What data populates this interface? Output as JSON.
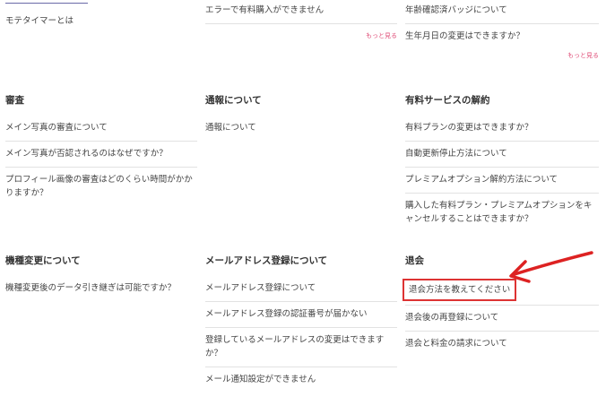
{
  "top": {
    "col1": [
      "モテタイマーとは"
    ],
    "col2": [
      "エラーで有料購入ができません"
    ],
    "col2_more": "もっと見る",
    "col3": [
      "年齢確認済バッジについて",
      "生年月日の変更はできますか？"
    ],
    "col3_more": "もっと見る"
  },
  "sections": [
    {
      "title": "審査",
      "items": [
        "メイン写真の審査について",
        "メイン写真が否認されるのはなぜですか？",
        "プロフィール画像の審査はどのくらい時間がかかりますか？"
      ]
    },
    {
      "title": "通報について",
      "items": [
        "通報について"
      ]
    },
    {
      "title": "有料サービスの解約",
      "items": [
        "有料プランの変更はできますか？",
        "自動更新停止方法について",
        "プレミアムオプション解約方法について",
        "購入した有料プラン・プレミアムオプションをキャンセルすることはできますか？"
      ]
    },
    {
      "title": "機種変更について",
      "items": [
        "機種変更後のデータ引き継ぎは可能ですか？"
      ]
    },
    {
      "title": "メールアドレス登録について",
      "items": [
        "メールアドレス登録について",
        "メールアドレス登録の認証番号が届かない",
        "登録しているメールアドレスの変更はできますか？",
        "メール通知設定ができません"
      ]
    },
    {
      "title": "退会",
      "items": [
        "退会方法を教えてください",
        "退会後の再登録について",
        "退会と料金の請求について"
      ]
    }
  ],
  "annotation_color": "#dd2222"
}
